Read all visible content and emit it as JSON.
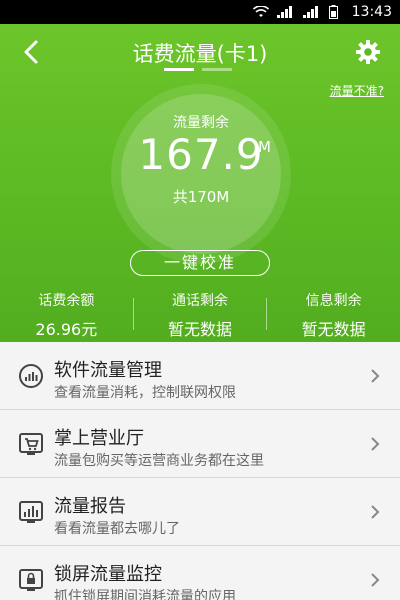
{
  "statusbar": {
    "time": "13:43"
  },
  "header": {
    "title": "话费流量(卡1)",
    "inaccurate_link": "流量不准?",
    "ring": {
      "label": "流量剩余",
      "value": "167.9",
      "unit": "M",
      "total": "共170M"
    },
    "calibrate_label": "一键校准",
    "stats": [
      {
        "label": "话费余额",
        "value": "26.96元"
      },
      {
        "label": "通话剩余",
        "value": "暂无数据"
      },
      {
        "label": "信息剩余",
        "value": "暂无数据"
      }
    ],
    "page_indicator": {
      "count": 2,
      "active": 0
    }
  },
  "list": {
    "items": [
      {
        "title": "软件流量管理",
        "subtitle": "查看流量消耗，控制联网权限",
        "icon": "speedometer-icon"
      },
      {
        "title": "掌上营业厅",
        "subtitle": "流量包购买等运营商业务都在这里",
        "icon": "cart-icon"
      },
      {
        "title": "流量报告",
        "subtitle": "看看流量都去哪儿了",
        "icon": "report-chart-icon"
      },
      {
        "title": "锁屏流量监控",
        "subtitle": "抓住锁屏期间消耗流量的应用",
        "icon": "lock-screen-icon"
      }
    ]
  },
  "colors": {
    "header_green": "#5bb823",
    "list_bg": "#f4f4f4",
    "text_dark": "#222222",
    "text_muted": "#666666"
  }
}
